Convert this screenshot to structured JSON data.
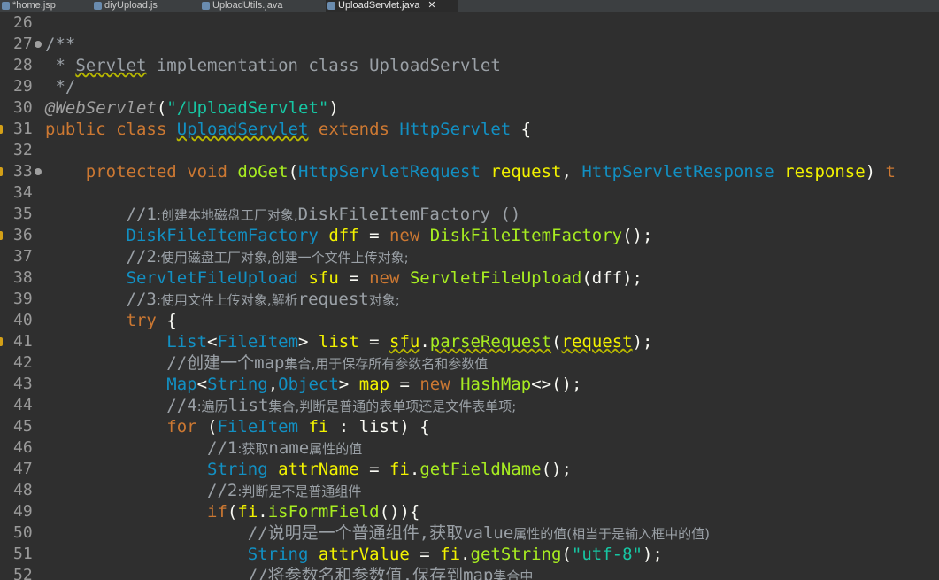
{
  "tabs": [
    {
      "label": "*home.jsp"
    },
    {
      "label": "diyUpload.js"
    },
    {
      "label": "UploadUtils.java"
    },
    {
      "label": "UploadServlet.java",
      "close": "✕"
    }
  ],
  "lines": [
    {
      "n": "26",
      "toks": []
    },
    {
      "n": "27",
      "fold": true,
      "toks": [
        [
          "cm",
          "/**"
        ]
      ]
    },
    {
      "n": "28",
      "toks": [
        [
          "cm",
          " * "
        ],
        [
          "cm sq",
          "Servlet"
        ],
        [
          "cm",
          " implementation class UploadServlet"
        ]
      ]
    },
    {
      "n": "29",
      "toks": [
        [
          "cm",
          " */"
        ]
      ]
    },
    {
      "n": "30",
      "toks": [
        [
          "ann",
          "@WebServlet"
        ],
        [
          "pn",
          "("
        ],
        [
          "str",
          "\"/UploadServlet\""
        ],
        [
          "pn",
          ")"
        ]
      ]
    },
    {
      "n": "31",
      "mark": true,
      "toks": [
        [
          "kw",
          "public class "
        ],
        [
          "ty sq",
          "UploadServlet"
        ],
        [
          "kw",
          " extends "
        ],
        [
          "ty",
          "HttpServlet"
        ],
        [
          "pn",
          " {"
        ]
      ]
    },
    {
      "n": "32",
      "toks": []
    },
    {
      "n": "33",
      "fold": true,
      "mark": true,
      "toks": [
        [
          "pn",
          "    "
        ],
        [
          "kw",
          "protected void "
        ],
        [
          "fn",
          "doGet"
        ],
        [
          "pn",
          "("
        ],
        [
          "ty",
          "HttpServletRequest"
        ],
        [
          "pn",
          " "
        ],
        [
          "var",
          "request"
        ],
        [
          "pn",
          ", "
        ],
        [
          "ty",
          "HttpServletResponse"
        ],
        [
          "pn",
          " "
        ],
        [
          "var",
          "response"
        ],
        [
          "pn",
          ") "
        ],
        [
          "kw",
          "t"
        ]
      ]
    },
    {
      "n": "34",
      "toks": []
    },
    {
      "n": "35",
      "toks": [
        [
          "pn",
          "        "
        ],
        [
          "cm",
          "//1"
        ],
        [
          "cmz",
          ":创建本地磁盘工厂对象,"
        ],
        [
          "cm",
          "DiskFileItemFactory ()"
        ]
      ]
    },
    {
      "n": "36",
      "mark": true,
      "toks": [
        [
          "pn",
          "        "
        ],
        [
          "ty",
          "DiskFileItemFactory"
        ],
        [
          "pn",
          " "
        ],
        [
          "var",
          "dff"
        ],
        [
          "pn",
          " = "
        ],
        [
          "kw",
          "new "
        ],
        [
          "fn",
          "DiskFileItemFactory"
        ],
        [
          "pn",
          "();"
        ]
      ]
    },
    {
      "n": "37",
      "toks": [
        [
          "pn",
          "        "
        ],
        [
          "cm",
          "//2"
        ],
        [
          "cmz",
          ":使用磁盘工厂对象,创建一个文件上传对象;"
        ]
      ]
    },
    {
      "n": "38",
      "toks": [
        [
          "pn",
          "        "
        ],
        [
          "ty",
          "ServletFileUpload"
        ],
        [
          "pn",
          " "
        ],
        [
          "var",
          "sfu"
        ],
        [
          "pn",
          " = "
        ],
        [
          "kw",
          "new "
        ],
        [
          "fn",
          "ServletFileUpload"
        ],
        [
          "pn",
          "(dff);"
        ]
      ]
    },
    {
      "n": "39",
      "toks": [
        [
          "pn",
          "        "
        ],
        [
          "cm",
          "//3"
        ],
        [
          "cmz",
          ":使用文件上传对象,解析"
        ],
        [
          "cm",
          "request"
        ],
        [
          "cmz",
          "对象;"
        ]
      ]
    },
    {
      "n": "40",
      "toks": [
        [
          "pn",
          "        "
        ],
        [
          "kw",
          "try"
        ],
        [
          "pn",
          " {"
        ]
      ]
    },
    {
      "n": "41",
      "mark": true,
      "toks": [
        [
          "pn",
          "            "
        ],
        [
          "ty",
          "List"
        ],
        [
          "pn",
          "<"
        ],
        [
          "ty",
          "FileItem"
        ],
        [
          "pn",
          "> "
        ],
        [
          "var",
          "list"
        ],
        [
          "pn",
          " = "
        ],
        [
          "var sq",
          "sfu"
        ],
        [
          "pn",
          "."
        ],
        [
          "fn sq",
          "parseRequest"
        ],
        [
          "pn",
          "("
        ],
        [
          "var sq",
          "request"
        ],
        [
          "pn",
          ");"
        ]
      ]
    },
    {
      "n": "42",
      "toks": [
        [
          "pn",
          "            "
        ],
        [
          "cm",
          "//创建一个map"
        ],
        [
          "cmz",
          "集合,用于保存所有参数名和参数值"
        ]
      ]
    },
    {
      "n": "43",
      "toks": [
        [
          "pn",
          "            "
        ],
        [
          "ty",
          "Map"
        ],
        [
          "pn",
          "<"
        ],
        [
          "ty",
          "String"
        ],
        [
          "pn",
          ","
        ],
        [
          "ty",
          "Object"
        ],
        [
          "pn",
          "> "
        ],
        [
          "var",
          "map"
        ],
        [
          "pn",
          " = "
        ],
        [
          "kw",
          "new "
        ],
        [
          "fn",
          "HashMap"
        ],
        [
          "pn",
          "<>();"
        ]
      ]
    },
    {
      "n": "44",
      "toks": [
        [
          "pn",
          "            "
        ],
        [
          "cm",
          "//4"
        ],
        [
          "cmz",
          ":遍历"
        ],
        [
          "cm",
          "list"
        ],
        [
          "cmz",
          "集合,判断是普通的表单项还是文件表单项;"
        ]
      ]
    },
    {
      "n": "45",
      "toks": [
        [
          "pn",
          "            "
        ],
        [
          "kw",
          "for"
        ],
        [
          "pn",
          " ("
        ],
        [
          "ty",
          "FileItem"
        ],
        [
          "pn",
          " "
        ],
        [
          "var",
          "fi"
        ],
        [
          "pn",
          " : list) {"
        ]
      ]
    },
    {
      "n": "46",
      "toks": [
        [
          "pn",
          "                "
        ],
        [
          "cm",
          "//1"
        ],
        [
          "cmz",
          ":获取"
        ],
        [
          "cm",
          "name"
        ],
        [
          "cmz",
          "属性的值"
        ]
      ]
    },
    {
      "n": "47",
      "toks": [
        [
          "pn",
          "                "
        ],
        [
          "ty",
          "String"
        ],
        [
          "pn",
          " "
        ],
        [
          "var",
          "attrName"
        ],
        [
          "pn",
          " = "
        ],
        [
          "var",
          "fi"
        ],
        [
          "pn",
          "."
        ],
        [
          "fn",
          "getFieldName"
        ],
        [
          "pn",
          "();"
        ]
      ]
    },
    {
      "n": "48",
      "toks": [
        [
          "pn",
          "                "
        ],
        [
          "cm",
          "//2"
        ],
        [
          "cmz",
          ":判断是不是普通组件"
        ]
      ]
    },
    {
      "n": "49",
      "toks": [
        [
          "pn",
          "                "
        ],
        [
          "kw",
          "if"
        ],
        [
          "pn",
          "("
        ],
        [
          "var",
          "fi"
        ],
        [
          "pn",
          "."
        ],
        [
          "fn",
          "isFormField"
        ],
        [
          "pn",
          "()){"
        ]
      ]
    },
    {
      "n": "50",
      "toks": [
        [
          "pn",
          "                    "
        ],
        [
          "cm",
          "//说明是一个普通组件,获取value"
        ],
        [
          "cmz",
          "属性的值(相当于是输入框中的值)"
        ]
      ]
    },
    {
      "n": "51",
      "toks": [
        [
          "pn",
          "                    "
        ],
        [
          "ty",
          "String"
        ],
        [
          "pn",
          " "
        ],
        [
          "var",
          "attrValue"
        ],
        [
          "pn",
          " = "
        ],
        [
          "var",
          "fi"
        ],
        [
          "pn",
          "."
        ],
        [
          "fn",
          "getString"
        ],
        [
          "pn",
          "("
        ],
        [
          "str",
          "\"utf-8\""
        ],
        [
          "pn",
          ");"
        ]
      ]
    },
    {
      "n": "52",
      "toks": [
        [
          "pn",
          "                    "
        ],
        [
          "cm",
          "//将参数名和参数值,保存到map"
        ],
        [
          "cmz",
          "集合中"
        ]
      ]
    }
  ]
}
